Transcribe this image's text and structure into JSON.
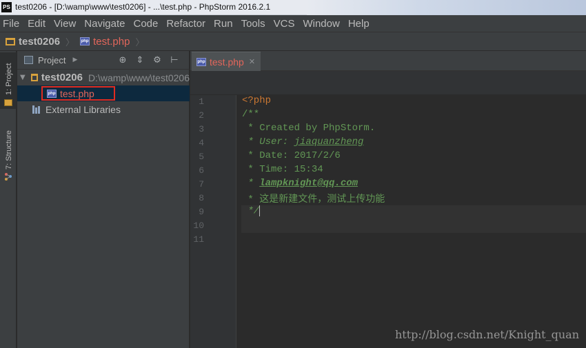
{
  "window": {
    "logo_text": "PS",
    "title": "test0206 - [D:\\wamp\\www\\test0206] - ...\\test.php - PhpStorm 2016.2.1"
  },
  "menu": [
    "File",
    "Edit",
    "View",
    "Navigate",
    "Code",
    "Refactor",
    "Run",
    "Tools",
    "VCS",
    "Window",
    "Help"
  ],
  "navbar": {
    "project": "test0206",
    "file": "test.php"
  },
  "toolstrip": {
    "project_tab": "1: Project",
    "structure_tab": "7: Structure"
  },
  "project_panel": {
    "view_label": "Project",
    "root": {
      "name": "test0206",
      "path": "D:\\wamp\\www\\test0206"
    },
    "files": [
      "test.php"
    ],
    "external": "External Libraries"
  },
  "editor": {
    "tab": "test.php",
    "line_numbers": [
      "1",
      "2",
      "3",
      "4",
      "5",
      "6",
      "7",
      "8",
      "9",
      "10",
      "11"
    ],
    "lines": {
      "l1": "<?php",
      "l2": "/**",
      "l3": " * Created by PhpStorm.",
      "l4_prefix": " * User: ",
      "l4_user": "jiaquanzheng",
      "l5": " * Date: 2017/2/6",
      "l6": " * Time: 15:34",
      "l7_prefix": " * ",
      "l7_email": "lampknight@qq.com",
      "l8": " * 这是新建文件，测试上传功能",
      "l9_prefix": " */"
    }
  },
  "watermark": "http://blog.csdn.net/Knight_quan",
  "colors": {
    "accent_file": "#e2665b",
    "keyword": "#cc7832",
    "doc_comment": "#629755",
    "highlight_box": "#e02b20"
  }
}
